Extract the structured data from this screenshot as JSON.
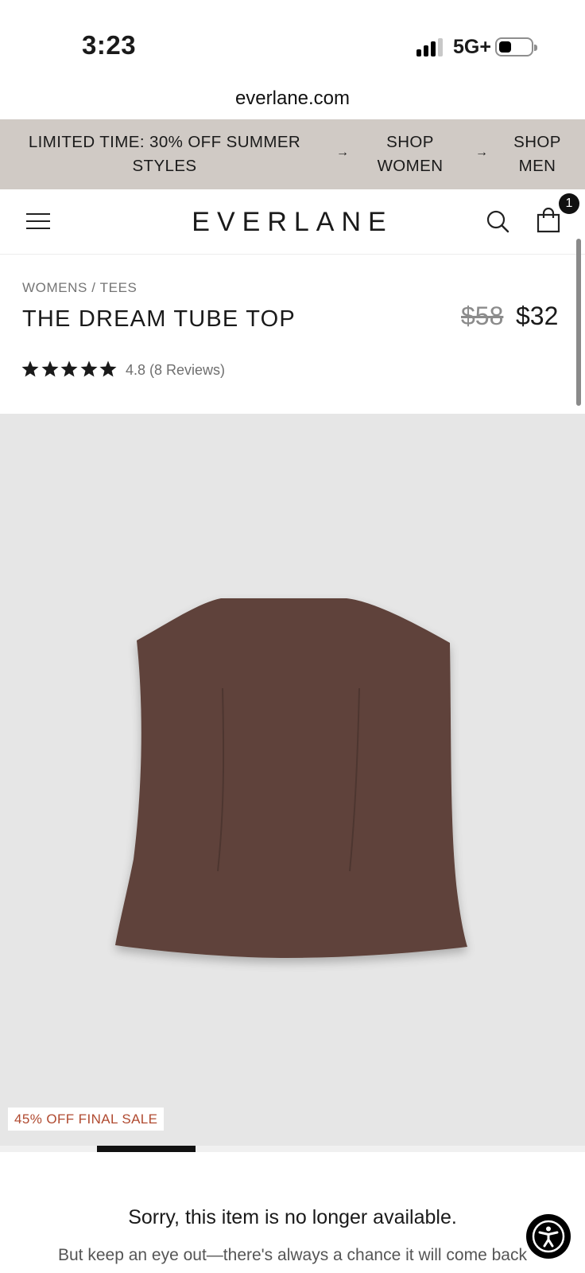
{
  "status_bar": {
    "time": "3:23",
    "network": "5G+"
  },
  "browser": {
    "url": "everlane.com"
  },
  "promo": {
    "message": "LIMITED TIME: 30% OFF SUMMER STYLES",
    "link1": "SHOP WOMEN",
    "link2": "SHOP MEN",
    "arrow": "→"
  },
  "header": {
    "logo": "EVERLANE",
    "cart_count": "1"
  },
  "product": {
    "breadcrumb": "WOMENS / TEES",
    "title": "THE DREAM TUBE TOP",
    "price_original": "$58",
    "price_sale": "$32",
    "rating_value": 4.8,
    "rating_text": "4.8 (8 Reviews)",
    "stars": 5,
    "badge": "45% OFF FINAL SALE",
    "image_color": "#5e433a"
  },
  "carousel": {
    "position": 2
  },
  "availability": {
    "message": "Sorry, this item is no longer available.",
    "sub": "But keep an eye out—there's always a chance it will come back later."
  }
}
